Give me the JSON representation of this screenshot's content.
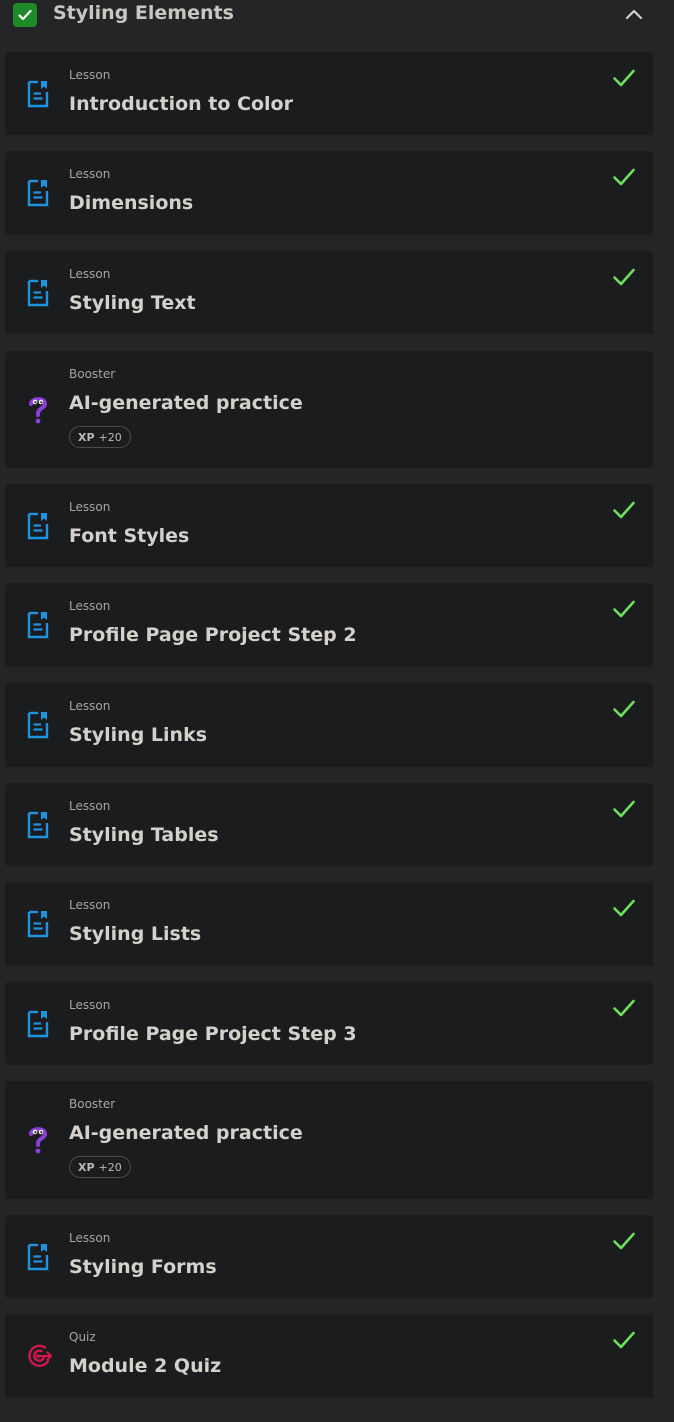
{
  "section": {
    "title": "Styling Elements",
    "completed": true,
    "check_icon": "check-icon",
    "collapse_icon": "chevron-up-icon"
  },
  "colors": {
    "lesson_icon": "#1e93e0",
    "booster_icon": "#8b3fd9",
    "quiz_icon": "#d0174e",
    "done_check": "#6ee05a",
    "section_check_bg": "#1f8a2a"
  },
  "items": [
    {
      "kind": "Lesson",
      "title": "Introduction to Color",
      "icon": "lesson-document-icon",
      "done": true
    },
    {
      "kind": "Lesson",
      "title": "Dimensions",
      "icon": "lesson-document-icon",
      "done": true
    },
    {
      "kind": "Lesson",
      "title": "Styling Text",
      "icon": "lesson-document-icon",
      "done": true
    },
    {
      "kind": "Booster",
      "title": "AI-generated practice",
      "icon": "question-mark-icon",
      "done": false,
      "xp_label": "XP",
      "xp_value": "+20"
    },
    {
      "kind": "Lesson",
      "title": "Font Styles",
      "icon": "lesson-document-icon",
      "done": true
    },
    {
      "kind": "Lesson",
      "title": "Profile Page Project Step 2",
      "icon": "lesson-document-icon",
      "done": true
    },
    {
      "kind": "Lesson",
      "title": "Styling Links",
      "icon": "lesson-document-icon",
      "done": true
    },
    {
      "kind": "Lesson",
      "title": "Styling Tables",
      "icon": "lesson-document-icon",
      "done": true
    },
    {
      "kind": "Lesson",
      "title": "Styling Lists",
      "icon": "lesson-document-icon",
      "done": true
    },
    {
      "kind": "Lesson",
      "title": "Profile Page Project Step 3",
      "icon": "lesson-document-icon",
      "done": true
    },
    {
      "kind": "Booster",
      "title": "AI-generated practice",
      "icon": "question-mark-icon",
      "done": false,
      "xp_label": "XP",
      "xp_value": "+20"
    },
    {
      "kind": "Lesson",
      "title": "Styling Forms",
      "icon": "lesson-document-icon",
      "done": true
    },
    {
      "kind": "Quiz",
      "title": "Module 2 Quiz",
      "icon": "target-icon",
      "done": true
    }
  ]
}
